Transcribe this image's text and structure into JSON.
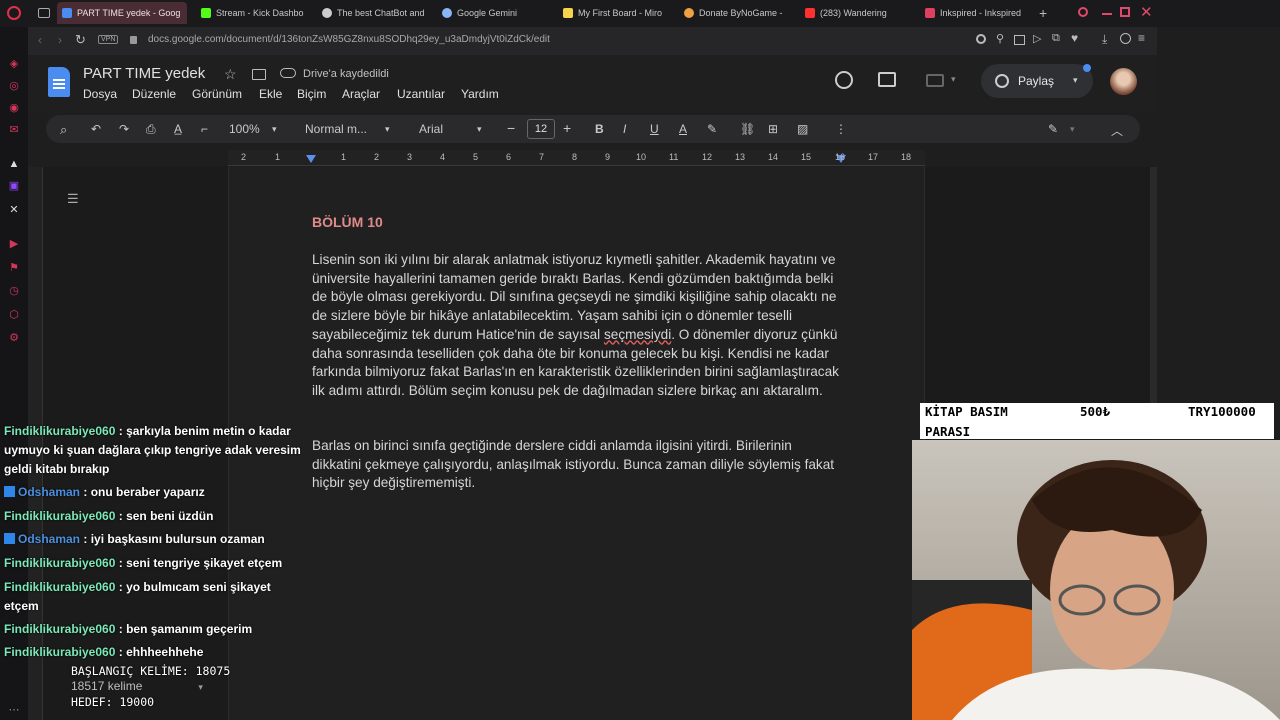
{
  "browser": {
    "tabs": [
      {
        "label": "PART TIME yedek - Goog",
        "active": true,
        "color": "#4a8cf0"
      },
      {
        "label": "Stream - Kick Dashbo",
        "active": false,
        "color": "#53fc18"
      },
      {
        "label": "The best ChatBot and",
        "active": false,
        "color": "#cccccc"
      },
      {
        "label": "Google Gemini",
        "active": false,
        "color": "#8ab4f8"
      },
      {
        "label": "My First Board - Miro",
        "active": false,
        "color": "#f8d24a"
      },
      {
        "label": "Donate ByNoGame -",
        "active": false,
        "color": "#f0a040"
      },
      {
        "label": "(283) Wandering",
        "active": false,
        "color": "#ff3030"
      },
      {
        "label": "Inkspired - Inkspired",
        "active": false,
        "color": "#e04060"
      }
    ],
    "new_tab": "+",
    "url": "docs.google.com/document/d/136tonZsW85GZ8nxu8SODhq29ey_u3aDmdyjVt0iZdCk/edit",
    "vpn": "VPN"
  },
  "docs": {
    "title": "PART TIME  yedek",
    "saved_status": "Drive'a kaydedildi",
    "menu": [
      "Dosya",
      "Düzenle",
      "Görünüm",
      "Ekle",
      "Biçim",
      "Araçlar",
      "Uzantılar",
      "Yardım"
    ],
    "share_label": "Paylaş",
    "toolbar": {
      "zoom": "100%",
      "style": "Normal m...",
      "font": "Arial",
      "font_size": "12"
    },
    "ruler_numbers": [
      "2",
      "1",
      "1",
      "2",
      "3",
      "4",
      "5",
      "6",
      "7",
      "8",
      "9",
      "10",
      "11",
      "12",
      "13",
      "14",
      "15",
      "16",
      "17",
      "18"
    ],
    "heading": "BÖLÜM 10",
    "para1_a": "Lisenin son iki yılını bir alarak anlatmak istiyoruz kıymetli şahitler. Akademik hayatını ve üniversite hayallerini tamamen geride bıraktı Barlas. Kendi gözümden baktığımda belki de böyle olması gerekiyordu. Dil sınıfına geçseydi ne şimdiki kişiliğine sahip olacaktı ne de sizlere böyle bir hikâye anlatabilecektim. Yaşam sahibi için o dönemler teselli sayabileceğimiz tek durum Hatice'nin de sayısal ",
    "para1_spell": "seçmesiydi",
    "para1_b": ". O dönemler diyoruz çünkü daha sonrasında teselliden çok daha öte bir konuma gelecek bu kişi. Kendisi ne kadar farkında bilmiyoruz fakat Barlas'ın en karakteristik özelliklerinden birini sağlamlaştıracak ilk adımı attırdı. Bölüm seçim konusu pek de dağılmadan sizlere birkaç anı aktaralım.",
    "para2": "Barlas on birinci sınıfa geçtiğinde derslere ciddi anlamda ilgisini yitirdi. Birilerinin dikkatini çekmeye çalışıyordu, anlaşılmak istiyordu. Bunca zaman diliyle söylemiş fakat hiçbir şey değiştirememişti.",
    "word_count": "18517 kelime"
  },
  "overlay": {
    "donation_goal": {
      "label_line1": "KİTAP BASIM",
      "label_line2": "PARASI",
      "current": "500₺",
      "target": "TRY100000"
    },
    "counter": {
      "start": "BAŞLANGIÇ KELİME: 18075",
      "goal": "HEDEF: 19000"
    },
    "chat": [
      {
        "user": "Findiklikurabiye060",
        "text": ": şarkıyla benim metin o kadar uymuyo ki şuan dağlara çıkıp tengriye adak veresim geldi kitabı bırakıp",
        "badge": false
      },
      {
        "user": "Odshaman",
        "text": ": onu beraber yaparız",
        "badge": true
      },
      {
        "user": "Findiklikurabiye060",
        "text": ": sen beni üzdün",
        "badge": false
      },
      {
        "user": "Odshaman",
        "text": ": iyi başkasını bulursun ozaman",
        "badge": true
      },
      {
        "user": "Findiklikurabiye060",
        "text": ": seni tengriye şikayet etçem",
        "badge": false
      },
      {
        "user": "Findiklikurabiye060",
        "text": ": yo bulmıcam seni şikayet etçem",
        "badge": false
      },
      {
        "user": "Findiklikurabiye060",
        "text": ": ben şamanım geçerim",
        "badge": false
      },
      {
        "user": "Findiklikurabiye060",
        "text": ": ehhheehhehe",
        "badge": false
      }
    ]
  }
}
